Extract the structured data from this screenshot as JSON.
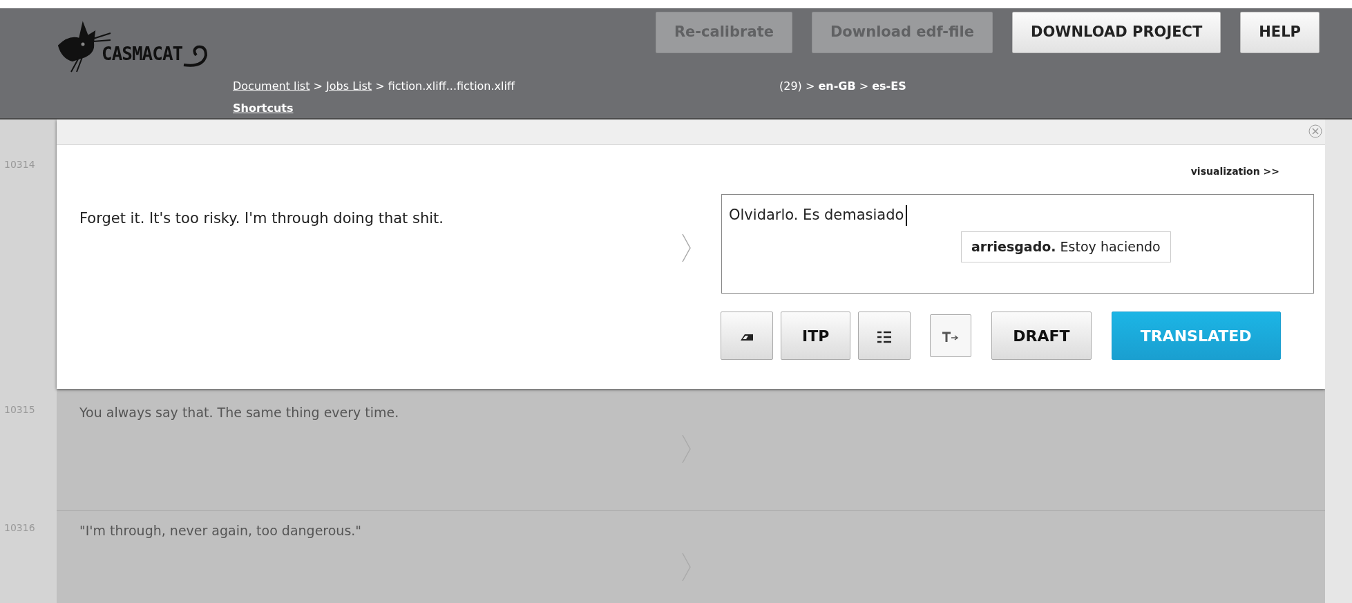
{
  "header": {
    "logo_text": "CASMACAT",
    "buttons": [
      {
        "label": "Re-calibrate",
        "disabled": true
      },
      {
        "label": "Download edf-file",
        "disabled": true
      },
      {
        "label": "DOWNLOAD PROJECT",
        "disabled": false
      },
      {
        "label": "HELP",
        "disabled": false
      }
    ],
    "breadcrumb": [
      {
        "kind": "link",
        "text": "Document list"
      },
      {
        "kind": "text",
        "text": ">"
      },
      {
        "kind": "link",
        "text": "Jobs List"
      },
      {
        "kind": "text",
        "text": "> fiction.xliff...fiction.xliff"
      }
    ],
    "shortcuts": "Shortcuts",
    "job_info": "(29) > **en-GB** > **es-ES**"
  },
  "segments": [
    {
      "number": "10314",
      "source": "Forget it. It's too risky. I'm through doing that shit.",
      "active": true,
      "visualization": "visualization >>",
      "target": "Olvidarlo. Es demasiado",
      "suggestion": "**arriesgado.** Estoy haciendo",
      "buttons": [
        {
          "kind": "eraser"
        },
        {
          "kind": "label",
          "label": "ITP"
        },
        {
          "kind": "list"
        },
        {
          "kind": "tag"
        },
        {
          "kind": "label",
          "label": "DRAFT"
        },
        {
          "kind": "primary",
          "label": "TRANSLATED"
        }
      ]
    },
    {
      "number": "10315",
      "source": "You always say that. The same thing every time.",
      "active": false
    },
    {
      "number": "10316",
      "source": "\"I'm through, never again, too dangerous.\"",
      "active": false
    }
  ]
}
